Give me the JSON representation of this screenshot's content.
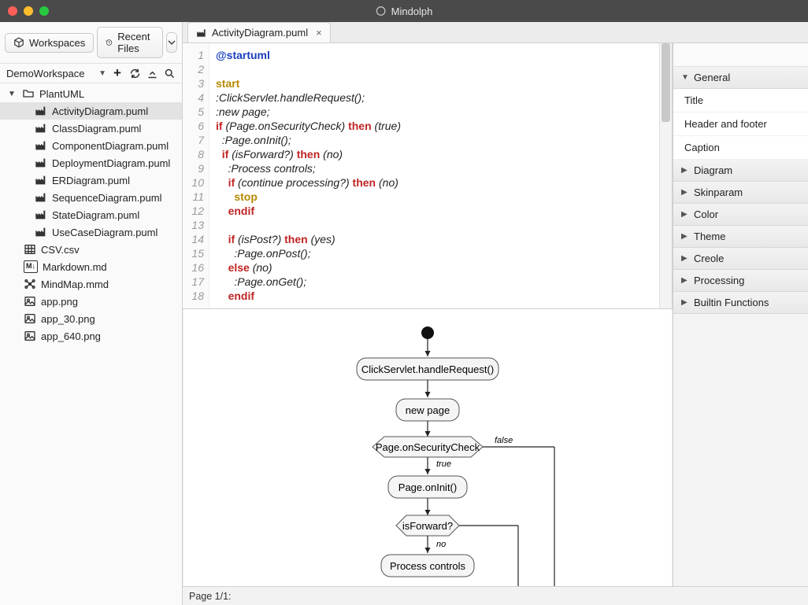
{
  "app_title": "Mindolph",
  "left_tabs": {
    "workspaces": "Workspaces",
    "recent_files": "Recent Files"
  },
  "workspace": {
    "name": "DemoWorkspace",
    "tree": {
      "root": "PlantUML",
      "children": [
        "ActivityDiagram.puml",
        "ClassDiagram.puml",
        "ComponentDiagram.puml",
        "DeploymentDiagram.puml",
        "ERDiagram.puml",
        "SequenceDiagram.puml",
        "StateDiagram.puml",
        "UseCaseDiagram.puml"
      ],
      "siblings": [
        {
          "name": "CSV.csv",
          "icon": "table"
        },
        {
          "name": "Markdown.md",
          "icon": "md"
        },
        {
          "name": "MindMap.mmd",
          "icon": "mm"
        },
        {
          "name": "app.png",
          "icon": "img"
        },
        {
          "name": "app_30.png",
          "icon": "img"
        },
        {
          "name": "app_640.png",
          "icon": "img"
        }
      ]
    }
  },
  "open_tab": {
    "label": "ActivityDiagram.puml"
  },
  "editor": {
    "lines": [
      {
        "n": 1,
        "segs": [
          {
            "t": "@startuml",
            "c": "at"
          }
        ]
      },
      {
        "n": 2,
        "segs": [
          {
            "t": "",
            "c": ""
          }
        ]
      },
      {
        "n": 3,
        "segs": [
          {
            "t": "start",
            "c": "kw-start"
          }
        ]
      },
      {
        "n": 4,
        "segs": [
          {
            "t": ":ClickServlet.handleRequest();",
            "c": ""
          }
        ]
      },
      {
        "n": 5,
        "segs": [
          {
            "t": ":new page;",
            "c": ""
          }
        ]
      },
      {
        "n": 6,
        "segs": [
          {
            "t": "if",
            "c": "kw-if"
          },
          {
            "t": " (Page.onSecurityCheck) ",
            "c": ""
          },
          {
            "t": "then",
            "c": "kw-then"
          },
          {
            "t": " (true)",
            "c": ""
          }
        ]
      },
      {
        "n": 7,
        "segs": [
          {
            "t": "  :Page.onInit();",
            "c": ""
          }
        ]
      },
      {
        "n": 8,
        "segs": [
          {
            "t": "  ",
            "c": ""
          },
          {
            "t": "if",
            "c": "kw-if"
          },
          {
            "t": " (isForward?) ",
            "c": ""
          },
          {
            "t": "then",
            "c": "kw-then"
          },
          {
            "t": " (no)",
            "c": ""
          }
        ]
      },
      {
        "n": 9,
        "segs": [
          {
            "t": "    :Process controls;",
            "c": ""
          }
        ]
      },
      {
        "n": 10,
        "segs": [
          {
            "t": "    ",
            "c": ""
          },
          {
            "t": "if",
            "c": "kw-if"
          },
          {
            "t": " (continue processing?) ",
            "c": ""
          },
          {
            "t": "then",
            "c": "kw-then"
          },
          {
            "t": " (no)",
            "c": ""
          }
        ]
      },
      {
        "n": 11,
        "segs": [
          {
            "t": "      ",
            "c": ""
          },
          {
            "t": "stop",
            "c": "kw-stop"
          }
        ]
      },
      {
        "n": 12,
        "segs": [
          {
            "t": "    ",
            "c": ""
          },
          {
            "t": "endif",
            "c": "kw-endif"
          }
        ]
      },
      {
        "n": 13,
        "segs": [
          {
            "t": "",
            "c": ""
          }
        ]
      },
      {
        "n": 14,
        "segs": [
          {
            "t": "    ",
            "c": ""
          },
          {
            "t": "if",
            "c": "kw-if"
          },
          {
            "t": " (isPost?) ",
            "c": ""
          },
          {
            "t": "then",
            "c": "kw-then"
          },
          {
            "t": " (yes)",
            "c": ""
          }
        ]
      },
      {
        "n": 15,
        "segs": [
          {
            "t": "      :Page.onPost();",
            "c": ""
          }
        ]
      },
      {
        "n": 16,
        "segs": [
          {
            "t": "    ",
            "c": ""
          },
          {
            "t": "else",
            "c": "kw-else"
          },
          {
            "t": " (no)",
            "c": ""
          }
        ]
      },
      {
        "n": 17,
        "segs": [
          {
            "t": "      :Page.onGet();",
            "c": ""
          }
        ]
      },
      {
        "n": 18,
        "segs": [
          {
            "t": "    ",
            "c": ""
          },
          {
            "t": "endif",
            "c": "kw-endif"
          }
        ]
      }
    ]
  },
  "sidebar": {
    "general": {
      "label": "General",
      "items": [
        "Title",
        "Header and footer",
        "Caption"
      ]
    },
    "sections": [
      "Diagram",
      "Skinparam",
      "Color",
      "Theme",
      "Creole",
      "Processing",
      "Builtin Functions"
    ]
  },
  "preview": {
    "nodes": {
      "n1": "ClickServlet.handleRequest()",
      "n2": "new page",
      "n3": "Page.onSecurityCheck",
      "n4": "Page.onInit()",
      "n5": "isForward?",
      "n6": "Process controls"
    },
    "edge_labels": {
      "true": "true",
      "false": "false",
      "no": "no"
    }
  },
  "status": {
    "page": "Page 1/1:"
  }
}
